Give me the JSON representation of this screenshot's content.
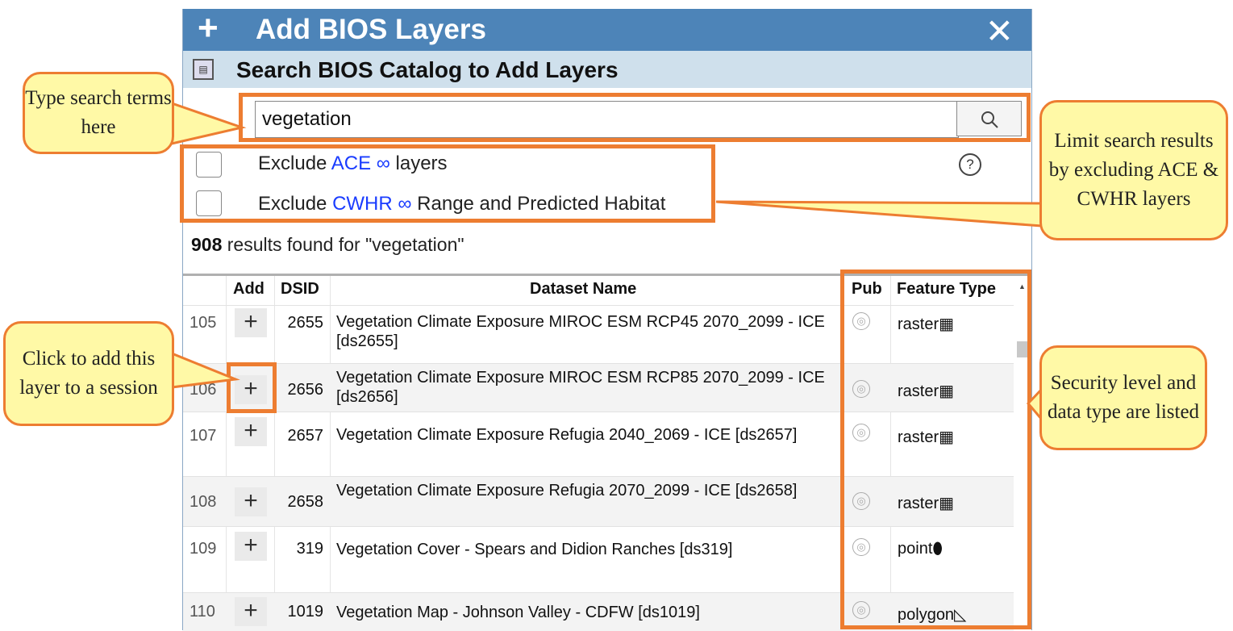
{
  "dialog": {
    "title": "Add BIOS Layers",
    "plus_glyph": "+",
    "close_glyph": "✕",
    "subtitle": "Search BIOS Catalog to Add Layers"
  },
  "search": {
    "arrow_glyph": "→",
    "value": "vegetation",
    "placeholder": ""
  },
  "filters": {
    "ace": {
      "prefix": "Exclude ",
      "link": "ACE ∞",
      "suffix": " layers"
    },
    "cwhr": {
      "prefix": "Exclude ",
      "link": "CWHR ∞",
      "suffix": " Range and Predicted Habitat"
    },
    "help_glyph": "?"
  },
  "results": {
    "count": "908",
    "text": " results found for \"vegetation\""
  },
  "table": {
    "headers": {
      "add": "Add",
      "dsid": "DSID",
      "name": "Dataset Name",
      "pub": "Pub",
      "ftype": "Feature Type"
    },
    "rows": [
      {
        "num": "105",
        "add": "+",
        "dsid": "2655",
        "name": "Vegetation Climate Exposure MIROC ESM RCP45 2070_2099 - ICE [ds2655]",
        "ftype": "raster▦"
      },
      {
        "num": "106",
        "add": "+",
        "dsid": "2656",
        "name": "Vegetation Climate Exposure MIROC ESM RCP85 2070_2099 - ICE [ds2656]",
        "ftype": "raster▦"
      },
      {
        "num": "107",
        "add": "+",
        "dsid": "2657",
        "name": "Vegetation Climate Exposure Refugia 2040_2069 - ICE [ds2657]",
        "ftype": "raster▦"
      },
      {
        "num": "108",
        "add": "+",
        "dsid": "2658",
        "name": "Vegetation Climate Exposure Refugia 2070_2099 - ICE [ds2658]",
        "ftype": "raster▦"
      },
      {
        "num": "109",
        "add": "+",
        "dsid": "319",
        "name": "Vegetation Cover - Spears and Didion Ranches [ds319]",
        "ftype": "point⬮"
      },
      {
        "num": "110",
        "add": "+",
        "dsid": "1019",
        "name": "Vegetation Map - Johnson Valley - CDFW [ds1019]",
        "ftype": "polygon◺"
      }
    ]
  },
  "callouts": {
    "search": "Type search terms here",
    "exclude": "Limit search results by excluding ACE & CWHR layers",
    "add": "Click to add this layer to a session",
    "security": "Security level and data type are listed"
  },
  "colors": {
    "titlebar": "#4d84b8",
    "subhead": "#cfe0ec",
    "highlight": "#ed7d31",
    "callout_fill": "#fff9a6",
    "link": "#1a3cff"
  }
}
